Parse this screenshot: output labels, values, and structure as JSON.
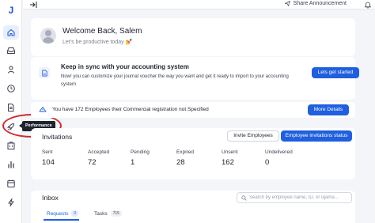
{
  "app": {
    "logo_letter": "J",
    "accent": "#1f5fe0"
  },
  "sidebar": {
    "items": [
      {
        "name": "home",
        "icon": "home-icon",
        "active": true
      },
      {
        "name": "inbox",
        "icon": "inbox-icon"
      },
      {
        "name": "profile",
        "icon": "user-icon"
      },
      {
        "name": "attendance",
        "icon": "clock-icon"
      },
      {
        "name": "payroll",
        "icon": "document-money-icon"
      },
      {
        "name": "performance",
        "icon": "rocket-icon",
        "tooltip": "Performance"
      },
      {
        "name": "organization",
        "icon": "building-icon"
      },
      {
        "name": "reports",
        "icon": "bar-chart-icon"
      },
      {
        "name": "calendar",
        "icon": "calendar-icon"
      },
      {
        "name": "automation",
        "icon": "lightning-icon"
      }
    ]
  },
  "topbar": {
    "share_label": "Share Announcement"
  },
  "welcome": {
    "title": "Welcome Back, Salem",
    "subtitle": "Let's be productive today 💅"
  },
  "sync": {
    "title": "Keep in sync with your accounting system",
    "description": "Now! you can customize your journal voucher the way you want and get it ready to import to your accounting system",
    "button_label": "Lets get started"
  },
  "alert": {
    "text": "You have 172 Employees their Commercial registration not Specified",
    "button_label": "More Details"
  },
  "invitations": {
    "title": "Invitations",
    "invite_button": "Invite Employees",
    "status_button": "Employee invitations status",
    "stats": [
      {
        "label": "Sent",
        "value": "104"
      },
      {
        "label": "Accepted",
        "value": "72"
      },
      {
        "label": "Pending",
        "value": "1"
      },
      {
        "label": "Expired",
        "value": "28"
      },
      {
        "label": "Unsent",
        "value": "162"
      },
      {
        "label": "Undelivered",
        "value": "0"
      }
    ]
  },
  "inbox": {
    "title": "Inbox",
    "search_placeholder": "Search by employee name, ID, or Iqama...",
    "tabs": [
      {
        "label": "Requests",
        "count": "0"
      },
      {
        "label": "Tasks",
        "count": "715"
      }
    ]
  }
}
